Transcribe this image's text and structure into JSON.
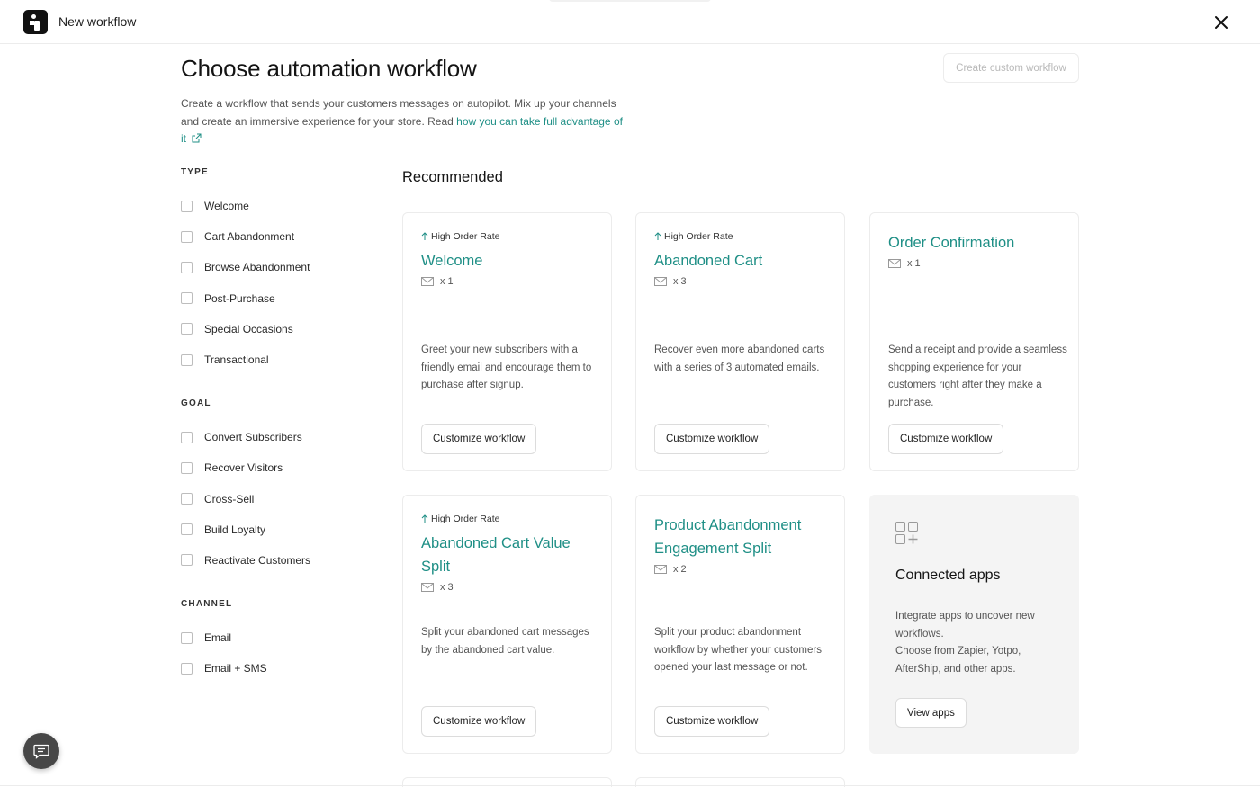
{
  "header": {
    "app_title": "New workflow"
  },
  "page": {
    "title": "Choose automation workflow",
    "create_button": "Create custom workflow",
    "intro_text": "Create a workflow that sends your customers messages on autopilot. Mix up your channels and create an immersive experience for your store. Read ",
    "intro_link": "how you can take full advantage of it"
  },
  "filters": {
    "type": {
      "heading": "TYPE",
      "items": [
        "Welcome",
        "Cart Abandonment",
        "Browse Abandonment",
        "Post-Purchase",
        "Special Occasions",
        "Transactional"
      ]
    },
    "goal": {
      "heading": "GOAL",
      "items": [
        "Convert Subscribers",
        "Recover Visitors",
        "Cross-Sell",
        "Build Loyalty",
        "Reactivate Customers"
      ]
    },
    "channel": {
      "heading": "CHANNEL",
      "items": [
        "Email",
        "Email + SMS"
      ]
    }
  },
  "recommended": {
    "title": "Recommended",
    "cards": [
      {
        "badge": "High Order Rate",
        "title": "Welcome",
        "count": "x 1",
        "desc": "Greet your new subscribers with a friendly email and encourage them to purchase after signup.",
        "button": "Customize workflow"
      },
      {
        "badge": "High Order Rate",
        "title": "Abandoned Cart",
        "count": "x 3",
        "desc": "Recover even more abandoned carts with a series of 3 automated emails.",
        "button": "Customize workflow"
      },
      {
        "badge": "",
        "title": "Order Confirmation",
        "count": "x 1",
        "desc": "Send a receipt and provide a seamless shopping experience for your customers right after they make a purchase.",
        "button": "Customize workflow"
      },
      {
        "badge": "High Order Rate",
        "title": "Abandoned Cart Value Split",
        "count": "x 3",
        "desc": "Split your abandoned cart messages by the abandoned cart value.",
        "button": "Customize workflow"
      },
      {
        "badge": "",
        "title": "Product Abandonment Engagement Split",
        "count": "x 2",
        "desc": "Split your product abandonment workflow by whether your customers opened your last message or not.",
        "button": "Customize workflow"
      }
    ],
    "apps": {
      "title": "Connected apps",
      "desc_line1": "Integrate apps to uncover new workflows.",
      "desc_line2": "Choose from Zapier, Yotpo, AfterShip, and other apps.",
      "button": "View apps"
    }
  },
  "icons": {
    "logo": "brand-logo",
    "close": "close-icon",
    "chat": "chat-icon",
    "mail": "mail-icon",
    "arrow": "arrow-up-icon",
    "apps": "apps-grid-plus-icon",
    "external": "external-link-icon"
  },
  "colors": {
    "accent": "#1f8f86",
    "text": "#1f1f1f",
    "muted": "#555555",
    "border": "#ececec"
  }
}
